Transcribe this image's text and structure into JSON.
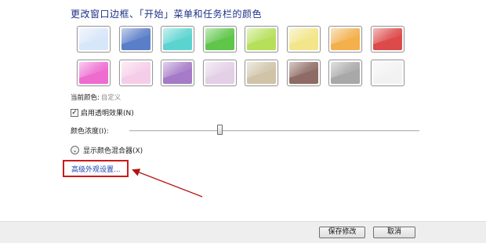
{
  "heading": "更改窗口边框、「开始」菜单和任务栏的颜色",
  "swatches": [
    {
      "name": "sky",
      "color": "#d8e6f9"
    },
    {
      "name": "twilight",
      "color": "#5a7ec8"
    },
    {
      "name": "sea",
      "color": "#5bd4d0"
    },
    {
      "name": "leaf",
      "color": "#5fc64a"
    },
    {
      "name": "lime",
      "color": "#b6e05a"
    },
    {
      "name": "lemon",
      "color": "#f3e58a"
    },
    {
      "name": "pumpkin",
      "color": "#f3b04c"
    },
    {
      "name": "ruby",
      "color": "#dd4a4a"
    },
    {
      "name": "fuchsia",
      "color": "#ee6bd0"
    },
    {
      "name": "blush",
      "color": "#f6cde8"
    },
    {
      "name": "violet",
      "color": "#a57ac8"
    },
    {
      "name": "lavender",
      "color": "#e3cfe6"
    },
    {
      "name": "taupe",
      "color": "#cfc3a8"
    },
    {
      "name": "chocolate",
      "color": "#8e6b64"
    },
    {
      "name": "slate",
      "color": "#a8a8a8"
    },
    {
      "name": "frost",
      "color": "#f2f2f2"
    }
  ],
  "current_color": {
    "label": "当前颜色:",
    "value": "自定义"
  },
  "transparency": {
    "label": "启用透明效果(N)",
    "checked": true,
    "check_glyph": "✓"
  },
  "intensity": {
    "label": "颜色浓度(I):",
    "value_fraction": 0.31
  },
  "mixer": {
    "label": "显示颜色混合器(X)",
    "chevron_glyph": "⌄"
  },
  "advanced_link": "高级外观设置...",
  "annotation": {
    "box_color": "#cc1a1a",
    "arrow_color": "#b31313"
  },
  "footer": {
    "save_label": "保存修改",
    "cancel_label": "取消"
  }
}
